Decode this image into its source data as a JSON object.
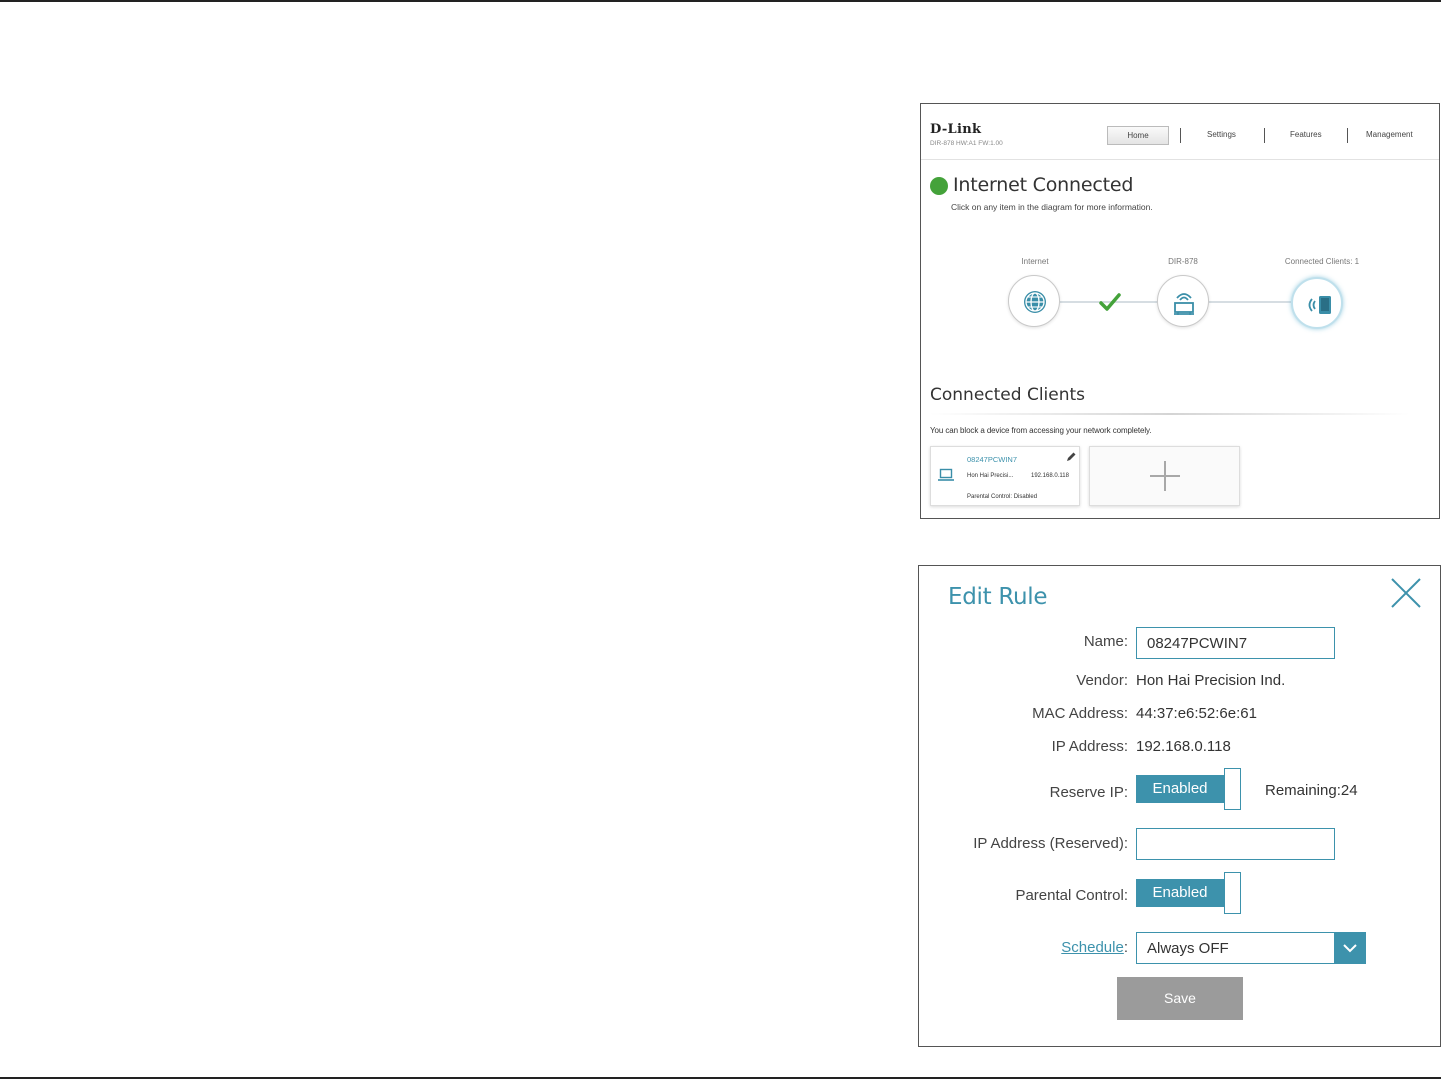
{
  "home": {
    "brand": "D-Link",
    "model_line": "DIR-878 HW:A1 FW:1.00",
    "nav": {
      "home": "Home",
      "settings": "Settings",
      "features": "Features",
      "management": "Management"
    },
    "status": {
      "title": "Internet Connected",
      "hint": "Click on any item in the diagram for more information.",
      "color": "#44a23a"
    },
    "diagram": {
      "internet_label": "Internet",
      "router_label": "DIR-878",
      "clients_label": "Connected Clients: 1"
    },
    "connected_clients": {
      "title": "Connected Clients",
      "hint": "You can block a device from accessing your network completely.",
      "client": {
        "name": "08247PCWIN7",
        "vendor": "Hon Hai Precisi...",
        "ip": "192.168.0.118",
        "parental": "Parental Control: Disabled"
      }
    }
  },
  "edit_rule": {
    "title": "Edit Rule",
    "accent_color": "#3d92ac",
    "fields": {
      "name_label": "Name:",
      "name_value": "08247PCWIN7",
      "vendor_label": "Vendor:",
      "vendor_value": "Hon Hai Precision Ind.",
      "mac_label": "MAC Address:",
      "mac_value": "44:37:e6:52:6e:61",
      "ip_label": "IP Address:",
      "ip_value": "192.168.0.118",
      "reserve_label": "Reserve IP:",
      "reserve_state": "Enabled",
      "remaining": "Remaining:24",
      "ip_reserved_label": "IP Address (Reserved):",
      "ip_reserved_value": "",
      "parental_label": "Parental Control:",
      "parental_state": "Enabled",
      "schedule_label": "Schedule",
      "schedule_colon": ":",
      "schedule_value": "Always OFF"
    },
    "save_label": "Save"
  }
}
